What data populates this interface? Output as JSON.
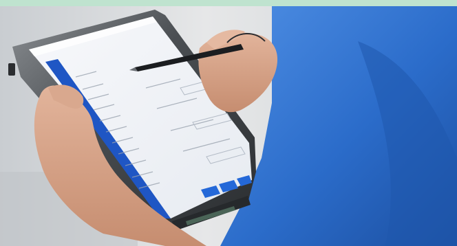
{
  "colors": {
    "top_band": "#bfe3cf",
    "background": "#d9dcde",
    "tablet_bezel": "#3a3d40",
    "screen": "#f2f4f7",
    "sidebar_blue": "#1f56c4",
    "button_blue": "#2468d8",
    "sleeve_blue": "#2f73cf",
    "skin": "#d7a489"
  },
  "icons": {
    "pen": "stylus-pen-icon"
  }
}
